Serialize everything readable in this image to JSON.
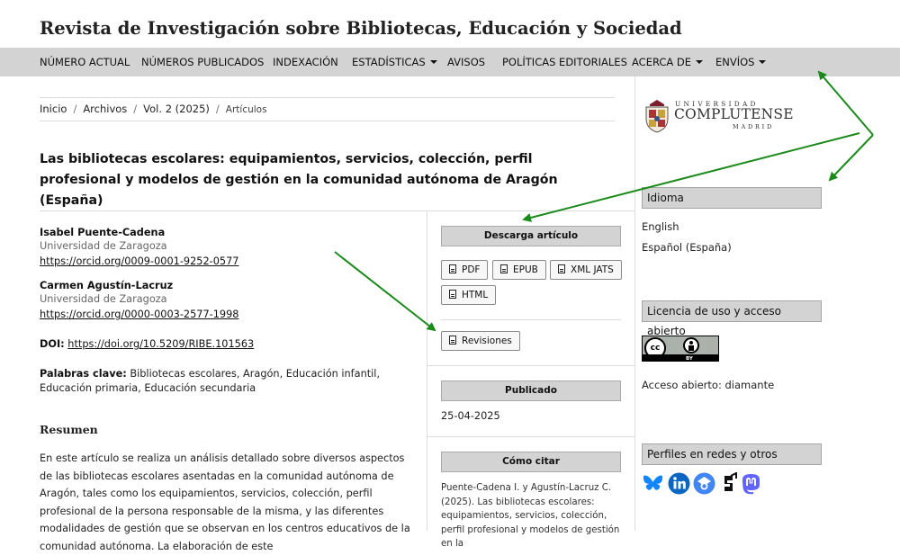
{
  "site": {
    "title": "Revista de Investigación sobre Bibliotecas, Educación y Sociedad"
  },
  "nav": {
    "items": [
      {
        "label": "NÚMERO ACTUAL"
      },
      {
        "label": "NÚMEROS PUBLICADOS"
      },
      {
        "label": "INDEXACIÓN"
      },
      {
        "label": "ESTADÍSTICAS"
      },
      {
        "label": "AVISOS"
      },
      {
        "label": "POLÍTICAS EDITORIALES"
      },
      {
        "label": "ACERCA DE"
      },
      {
        "label": "ENVÍOS"
      }
    ]
  },
  "breadcrumb": {
    "home": "Inicio",
    "archives": "Archivos",
    "issue": "Vol. 2 (2025)",
    "current": "Artículos",
    "separator": "/"
  },
  "article": {
    "title": "Las bibliotecas escolares: equipamientos, servicios, colección, perfil profesional y modelos de gestión en la comunidad autónoma de Aragón (España)",
    "authors": [
      {
        "name": "Isabel Puente-Cadena",
        "affiliation": "Universidad de Zaragoza",
        "orcid": "https://orcid.org/0009-0001-9252-0577"
      },
      {
        "name": "Carmen Agustín-Lacruz",
        "affiliation": "Universidad de Zaragoza",
        "orcid": "https://orcid.org/0000-0003-2577-1998"
      }
    ],
    "doi_label": "DOI:",
    "doi": "https://doi.org/10.5209/RIBE.101563",
    "keywords_label": "Palabras clave:",
    "keywords": "Bibliotecas escolares, Aragón, Educación infantil, Educación primaria, Educación secundaria",
    "abstract_heading": "Resumen",
    "abstract": "En este artículo se realiza un análisis detallado sobre diversos aspectos de las bibliotecas escolares asentadas en la comunidad autónoma de Aragón, tales como los equipamientos, servicios, colección, perfil profesional de la persona responsable de la misma, y las diferentes modalidades de gestión que se observan en los centros educativos de la comunidad autónoma. La elaboración de este"
  },
  "details": {
    "download_header": "Descarga artículo",
    "galleys": [
      {
        "label": "PDF"
      },
      {
        "label": "EPUB"
      },
      {
        "label": "XML JATS"
      },
      {
        "label": "HTML"
      }
    ],
    "revisions_label": "Revisiones",
    "published_header": "Publicado",
    "published_date": "25-04-2025",
    "cite_header": "Cómo citar",
    "citation": "Puente-Cadena I. y Agustín-Lacruz C. (2025). Las bibliotecas escolares: equipamientos, servicios, colección, perfil profesional y modelos de gestión en la"
  },
  "sidebar": {
    "logo": {
      "line1": "UNIVERSIDAD",
      "line2": "COMPLUTENSE",
      "line3": "MADRID"
    },
    "language_title": "Idioma",
    "languages": [
      {
        "label": "English"
      },
      {
        "label": "Español (España)"
      }
    ],
    "license_title": "Licencia de uso y acceso abierto",
    "license_badge": {
      "cc": "cc",
      "by": "BY"
    },
    "access_text": "Acceso abierto: diamante",
    "social_title": "Perfiles en redes y otros",
    "social_icons": [
      "bluesky-icon",
      "linkedin-icon",
      "google-scholar-icon",
      "researchgate-icon",
      "mastodon-icon"
    ]
  },
  "colors": {
    "nav_bg": "#d3d3d3",
    "arrow": "#1a8a1a",
    "bluesky": "#1185fe",
    "linkedin": "#0a66c2",
    "scholar": "#4285f4",
    "mastodon": "#6364ff"
  }
}
